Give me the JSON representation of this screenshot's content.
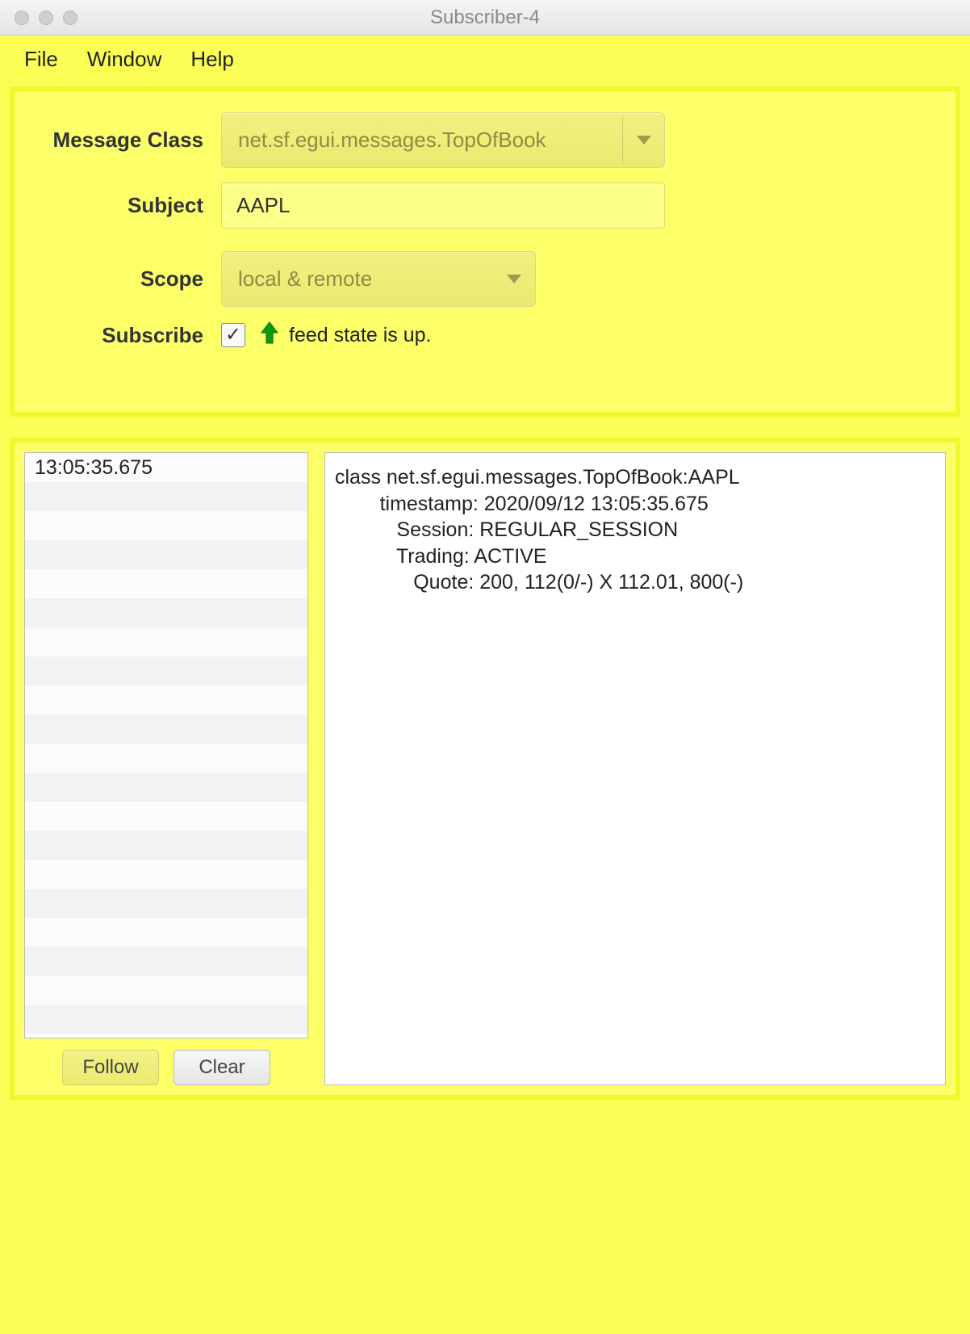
{
  "window": {
    "title": "Subscriber-4"
  },
  "menu": {
    "file": "File",
    "window": "Window",
    "help": "Help"
  },
  "form": {
    "message_class_label": "Message Class",
    "message_class_value": "net.sf.egui.messages.TopOfBook",
    "subject_label": "Subject",
    "subject_value": "AAPL",
    "scope_label": "Scope",
    "scope_value": "local & remote",
    "subscribe_label": "Subscribe",
    "subscribe_checked": true,
    "feed_state_text": "feed state is up."
  },
  "list": {
    "items": [
      "13:05:35.675"
    ]
  },
  "buttons": {
    "follow": "Follow",
    "clear": "Clear"
  },
  "detail": {
    "line0": "class net.sf.egui.messages.TopOfBook:AAPL",
    "line1": "        timestamp: 2020/09/12 13:05:35.675",
    "line2": "           Session: REGULAR_SESSION",
    "line3": "           Trading: ACTIVE",
    "line4": "              Quote: 200, 112(0/-) X 112.01, 800(-)"
  }
}
